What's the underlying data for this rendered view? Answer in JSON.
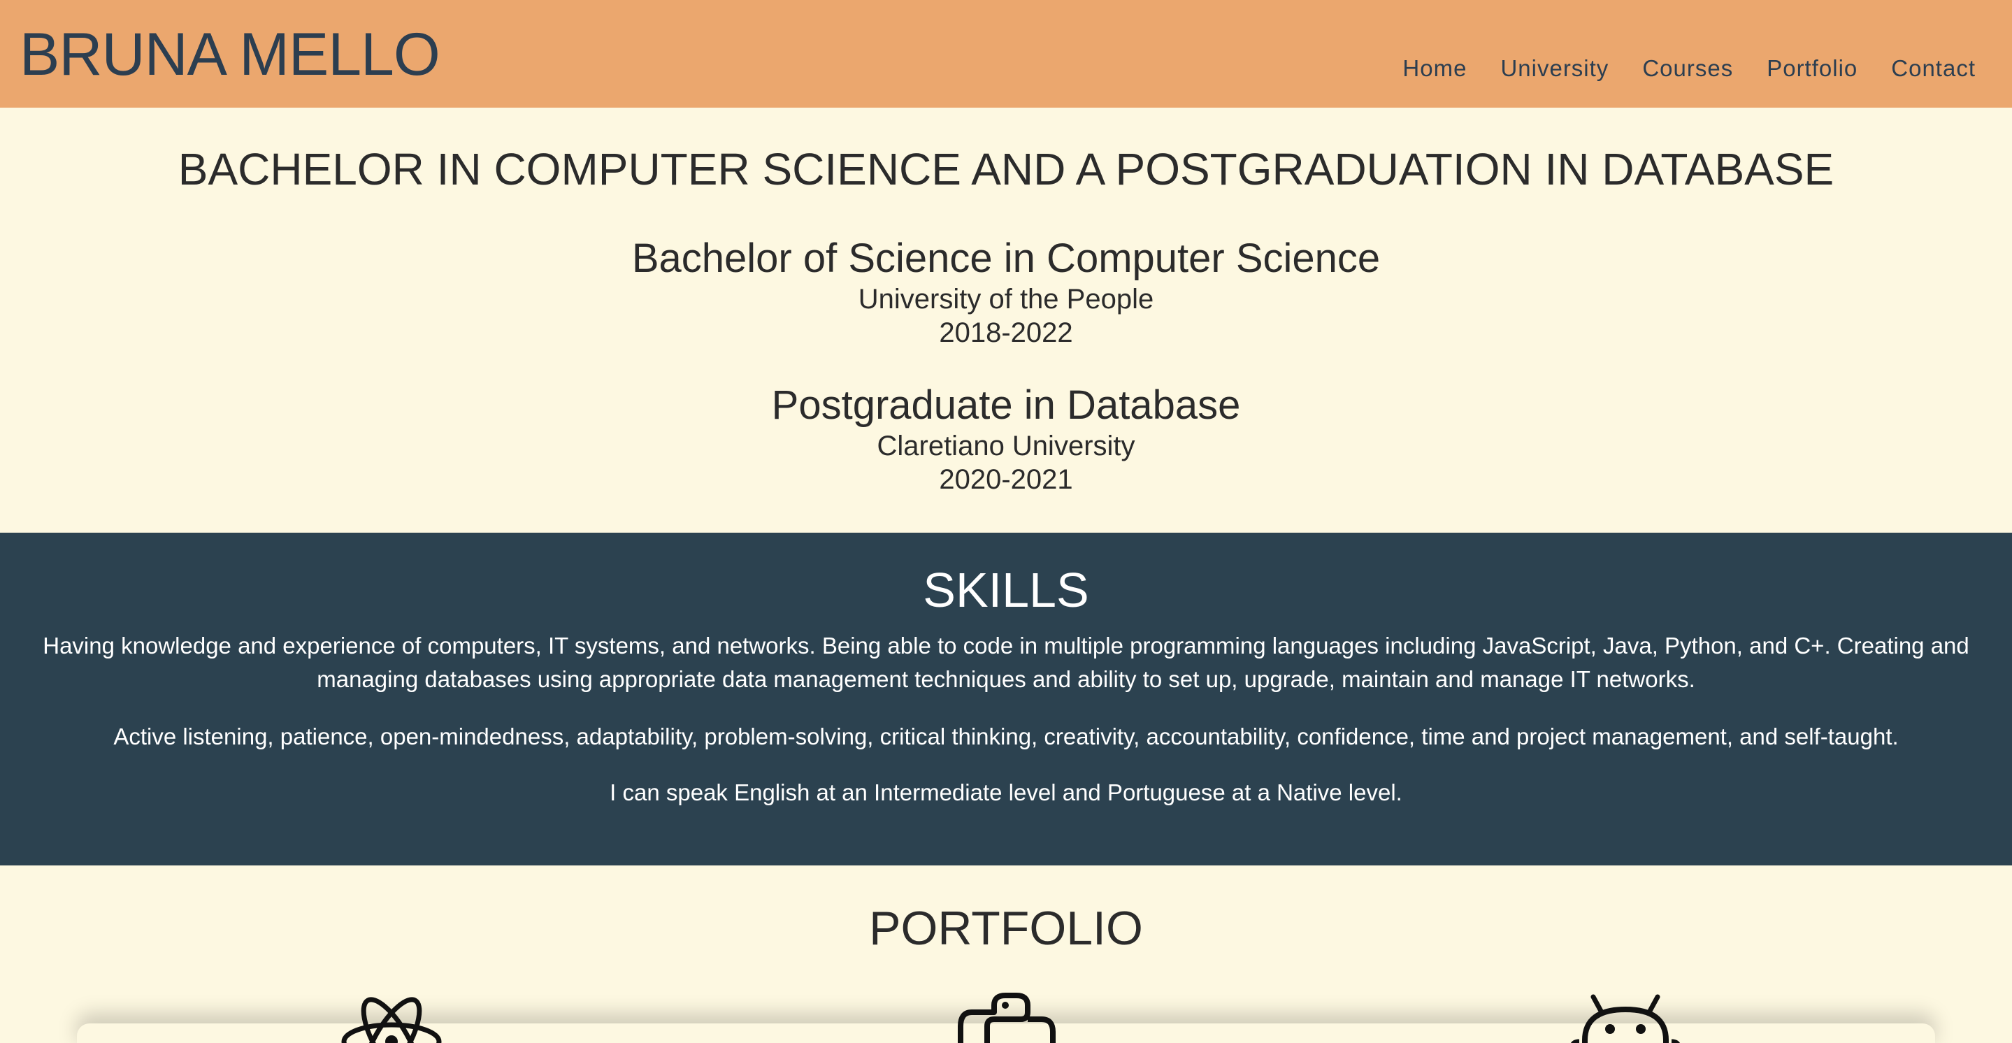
{
  "header": {
    "brand": "BRUNA MELLO",
    "nav": {
      "home": "Home",
      "university": "University",
      "courses": "Courses",
      "portfolio": "Portfolio",
      "contact": "Contact"
    }
  },
  "education": {
    "heading": "BACHELOR IN COMPUTER SCIENCE AND A POSTGRADUATION IN DATABASE",
    "degrees": [
      {
        "title": "Bachelor of Science in Computer Science",
        "school": "University of the People",
        "years": "2018-2022"
      },
      {
        "title": "Postgraduate in Database",
        "school": "Claretiano University",
        "years": "2020-2021"
      }
    ]
  },
  "skills": {
    "title": "SKILLS",
    "paragraphs": [
      "Having knowledge and experience of computers, IT systems, and networks. Being able to code in multiple programming languages including JavaScript, Java, Python, and C+. Creating and managing databases using appropriate data management techniques and ability to set up, upgrade, maintain and manage IT networks.",
      "Active listening, patience, open-mindedness, adaptability, problem-solving, critical thinking, creativity, accountability, confidence, time and project management, and self-taught.",
      "I can speak English at an Intermediate level and Portuguese at a Native level."
    ]
  },
  "portfolio": {
    "title": "PORTFOLIO",
    "icons": [
      "react-icon",
      "python-icon",
      "android-icon"
    ]
  },
  "colors": {
    "header_bg": "#eba76e",
    "page_bg": "#fdf8e1",
    "skills_bg": "#2c4250",
    "brand_text": "#2c3e50"
  }
}
